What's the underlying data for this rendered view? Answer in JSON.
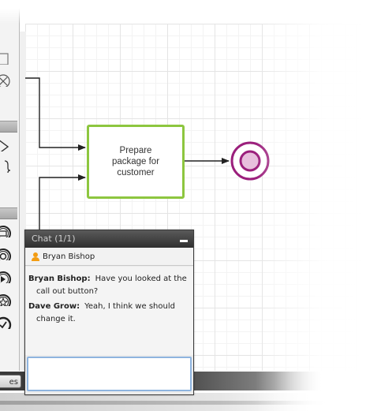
{
  "diagram": {
    "task_label": "Prepare package for customer",
    "colors": {
      "task_border": "#8dc63f",
      "end_event": "#9b1f7c",
      "end_event_fill": "#e8bfdd",
      "flow": "#222222"
    },
    "palette_icons": [
      "square-icon",
      "error-event-icon",
      "gateway-icon",
      "bracket-icon",
      "message-event-icon",
      "signal-event-icon",
      "compensation-event-icon",
      "star-event-icon",
      "check-event-icon"
    ]
  },
  "chat": {
    "title": "Chat (1/1)",
    "user_name": "Bryan Bishop",
    "messages": [
      {
        "sender": "Bryan Bishop:",
        "text": "Have you looked at the call out button?"
      },
      {
        "sender": "Dave Grow:",
        "text": "Yeah, I think we  should change it."
      }
    ],
    "input_value": "",
    "colors": {
      "header": "#3a3a3a",
      "user_icon": "#f39c12",
      "input_border": "#8eb4df"
    }
  },
  "bottom": {
    "tab_label": "es"
  }
}
